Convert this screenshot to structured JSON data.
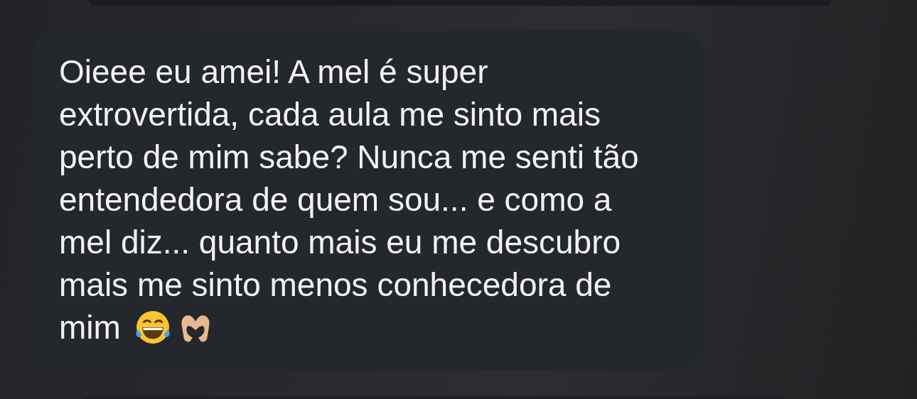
{
  "message": {
    "lines": [
      "Oieee eu amei! A mel é super",
      "extrovertida, cada aula me sinto mais",
      "perto de mim sabe? Nunca me senti tão",
      "entendedora de quem sou... e como a",
      "mel diz... quanto mais eu me descubro",
      "mais me sinto menos conhecedora de",
      "mim"
    ]
  }
}
